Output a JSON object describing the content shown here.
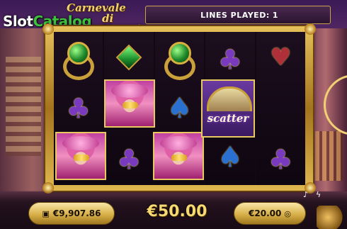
{
  "brand": {
    "part1": "Slot",
    "part2": "Catalog",
    "accent": "#3ec23e"
  },
  "game_title": {
    "line1": "Carnevale",
    "line2": "di Venezia"
  },
  "lines_played": {
    "label": "LINES PLAYED:",
    "value": "1"
  },
  "reels": [
    [
      "green-ring",
      "club",
      "pink-lady"
    ],
    [
      "green-diamond",
      "pink-lady",
      "club"
    ],
    [
      "green-ring",
      "spade",
      "pink-lady"
    ],
    [
      "club",
      "fan",
      "spade"
    ],
    [
      "heart",
      "scatter",
      "club"
    ]
  ],
  "scatter_label": "scatter",
  "footer": {
    "balance": "€9,907.86",
    "bet_amount": "€50.00",
    "bet_per_line": "€20.00"
  },
  "icons": {
    "wallet": "wallet-icon",
    "coins": "coins-icon",
    "sound": "music-note-icon",
    "turbo": "lightning-icon"
  },
  "colors": {
    "gold": "#e8c860",
    "frame_dark": "#6a4210"
  }
}
